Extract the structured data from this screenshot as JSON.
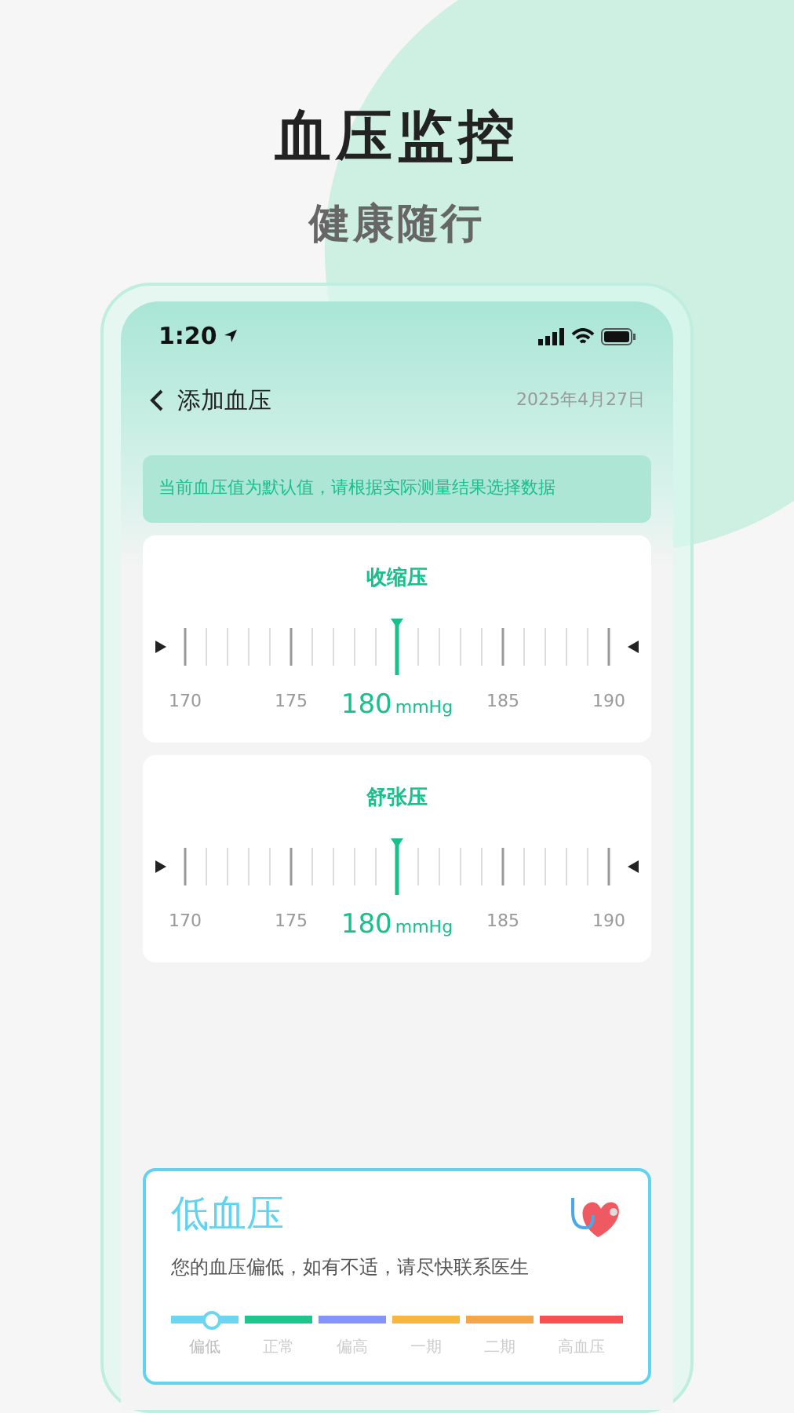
{
  "headline": "血压监控",
  "subheadline": "健康随行",
  "status_bar": {
    "time": "1:20"
  },
  "nav": {
    "title": "添加血压",
    "date": "2025年4月27日"
  },
  "notice": "当前血压值为默认值，请根据实际测量结果选择数据",
  "rulers": [
    {
      "title": "收缩压",
      "unit": "mmHg",
      "labels": [
        {
          "text": "170",
          "selected": false
        },
        {
          "text": "175",
          "selected": false
        },
        {
          "text": "180",
          "selected": true
        },
        {
          "text": "185",
          "selected": false
        },
        {
          "text": "190",
          "selected": false
        }
      ]
    },
    {
      "title": "舒张压",
      "unit": "mmHg",
      "labels": [
        {
          "text": "170",
          "selected": false
        },
        {
          "text": "175",
          "selected": false
        },
        {
          "text": "180",
          "selected": true
        },
        {
          "text": "185",
          "selected": false
        },
        {
          "text": "190",
          "selected": false
        }
      ]
    }
  ],
  "result": {
    "title": "低血压",
    "message": "您的血压偏低，如有不适，请尽快联系医生",
    "color": "#5fd3ef",
    "segments": [
      {
        "label": "偏低",
        "color": "#6dd5f2",
        "selected": true
      },
      {
        "label": "正常",
        "color": "#1fc48e",
        "selected": false
      },
      {
        "label": "偏高",
        "color": "#8494f7",
        "selected": false
      },
      {
        "label": "一期",
        "color": "#f6b73c",
        "selected": false
      },
      {
        "label": "二期",
        "color": "#f4a74a",
        "selected": false
      },
      {
        "label": "高血压",
        "color": "#f65252",
        "selected": false
      }
    ]
  }
}
